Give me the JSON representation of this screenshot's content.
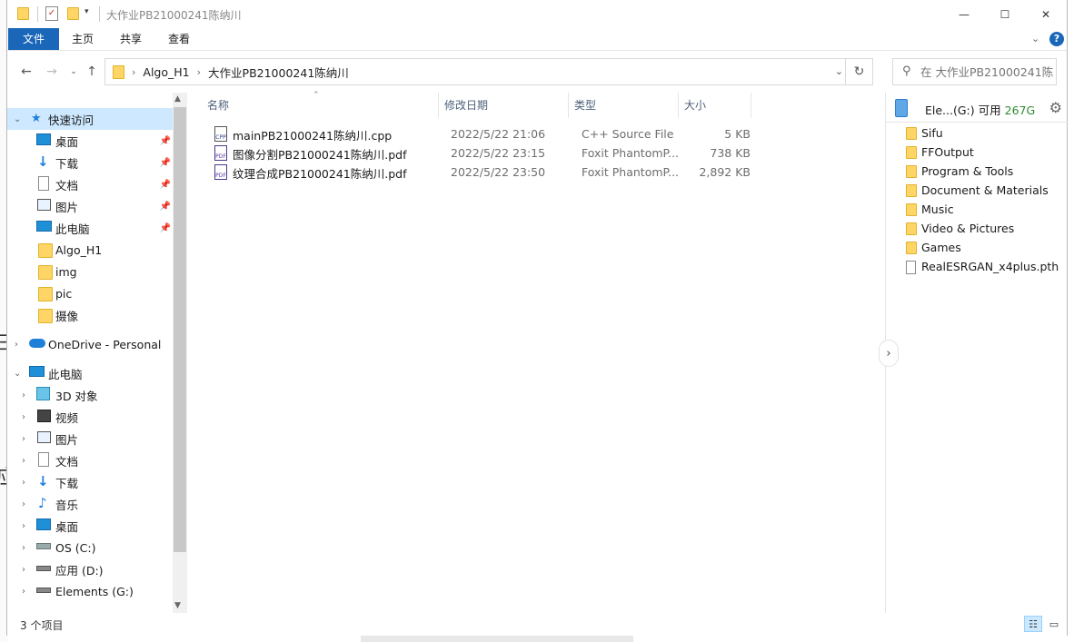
{
  "window": {
    "title": "大作业PB21000241陈纳川",
    "controls": {
      "minimize": "—",
      "maximize": "☐",
      "close": "✕"
    }
  },
  "ribbon": {
    "tabs": [
      {
        "label": "文件",
        "active": true
      },
      {
        "label": "主页"
      },
      {
        "label": "共享"
      },
      {
        "label": "查看"
      }
    ],
    "help_icon": "?"
  },
  "address": {
    "crumbs": [
      "Algo_H1",
      "大作业PB21000241陈纳川"
    ],
    "search_placeholder": "在 大作业PB21000241陈..."
  },
  "nav": {
    "quick_access": "快速访问",
    "quick_items": [
      {
        "label": "桌面",
        "pinned": true
      },
      {
        "label": "下载",
        "pinned": true
      },
      {
        "label": "文档",
        "pinned": true
      },
      {
        "label": "图片",
        "pinned": true
      },
      {
        "label": "此电脑",
        "pinned": true
      },
      {
        "label": "Algo_H1"
      },
      {
        "label": "img"
      },
      {
        "label": "pic"
      },
      {
        "label": "摄像"
      }
    ],
    "onedrive": "OneDrive - Personal",
    "this_pc": "此电脑",
    "pc_items": [
      {
        "label": "3D 对象"
      },
      {
        "label": "视频"
      },
      {
        "label": "图片"
      },
      {
        "label": "文档"
      },
      {
        "label": "下载"
      },
      {
        "label": "音乐"
      },
      {
        "label": "桌面"
      },
      {
        "label": "OS (C:)"
      },
      {
        "label": "应用 (D:)"
      },
      {
        "label": "Elements (G:)"
      }
    ]
  },
  "columns": {
    "name": "名称",
    "date": "修改日期",
    "type": "类型",
    "size": "大小"
  },
  "files": [
    {
      "name": "mainPB21000241陈纳川.cpp",
      "date": "2022/5/22 21:06",
      "type": "C++ Source File",
      "size": "5 KB",
      "icon": "cpp-file-icon"
    },
    {
      "name": "图像分割PB21000241陈纳川.pdf",
      "date": "2022/5/22 23:15",
      "type": "Foxit PhantomP...",
      "size": "738 KB",
      "icon": "pdf-file-icon"
    },
    {
      "name": "纹理合成PB21000241陈纳川.pdf",
      "date": "2022/5/22 23:50",
      "type": "Foxit PhantomP...",
      "size": "2,892 KB",
      "icon": "pdf-file-icon"
    }
  ],
  "drive_pane": {
    "drive_label": "Ele...(G:)",
    "free_label": "可用",
    "free_value": "267G",
    "items": [
      {
        "label": "Sifu",
        "kind": "folder"
      },
      {
        "label": "FFOutput",
        "kind": "folder"
      },
      {
        "label": "Program & Tools",
        "kind": "folder"
      },
      {
        "label": "Document & Materials",
        "kind": "folder"
      },
      {
        "label": "Music",
        "kind": "folder"
      },
      {
        "label": "Video & Pictures",
        "kind": "folder"
      },
      {
        "label": "Games",
        "kind": "folder"
      },
      {
        "label": "RealESRGAN_x4plus.pth",
        "kind": "file"
      }
    ]
  },
  "status": {
    "count": "3 个项目"
  },
  "colors": {
    "accent": "#1a66b8",
    "selection": "#cde8ff",
    "free_space": "#2e8b2e"
  }
}
